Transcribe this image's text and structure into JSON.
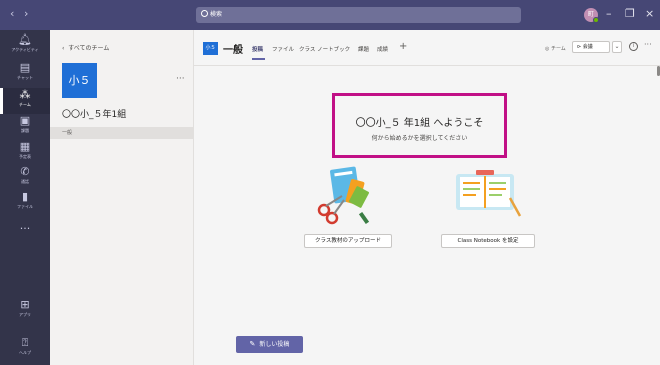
{
  "titlebar": {
    "search_placeholder": "検索",
    "avatar_initial": "町",
    "colors": {
      "bar": "#464775",
      "presence": "#6bb700"
    }
  },
  "rail": {
    "items": [
      {
        "label": "アクティビティ",
        "icon": "bell-icon"
      },
      {
        "label": "チャット",
        "icon": "chat-icon"
      },
      {
        "label": "チーム",
        "icon": "teams-icon",
        "active": true
      },
      {
        "label": "課題",
        "icon": "assignments-icon"
      },
      {
        "label": "予定表",
        "icon": "calendar-icon"
      },
      {
        "label": "通話",
        "icon": "phone-icon"
      },
      {
        "label": "ファイル",
        "icon": "file-icon"
      }
    ],
    "more": "···",
    "apps_label": "アプリ",
    "help_label": "ヘルプ"
  },
  "team_pane": {
    "back_label": "すべてのチーム",
    "team_tile": "小５",
    "team_name": "〇〇小_５年1組",
    "team_more": "···",
    "channel": "一般"
  },
  "header": {
    "channel_tile": "小５",
    "channel_title": "一般",
    "tabs": [
      {
        "label": "投稿",
        "active": true
      },
      {
        "label": "ファイル"
      },
      {
        "label": "クラス ノートブック"
      },
      {
        "label": "課題"
      },
      {
        "label": "成績"
      }
    ],
    "add_tab": "+",
    "team_label": "チーム",
    "meet_label": "会議",
    "info": "i",
    "more": "···"
  },
  "content": {
    "welcome_title": "〇〇小_５ 年1組 へようこそ",
    "welcome_subtitle": "何から始めるかを選択してください",
    "upload_button": "クラス教材のアップロード",
    "notebook_button": "Class Notebook を設定",
    "new_post_button": "新しい投稿",
    "colors": {
      "highlight": "#c10f86",
      "accent": "#6264a7"
    }
  }
}
